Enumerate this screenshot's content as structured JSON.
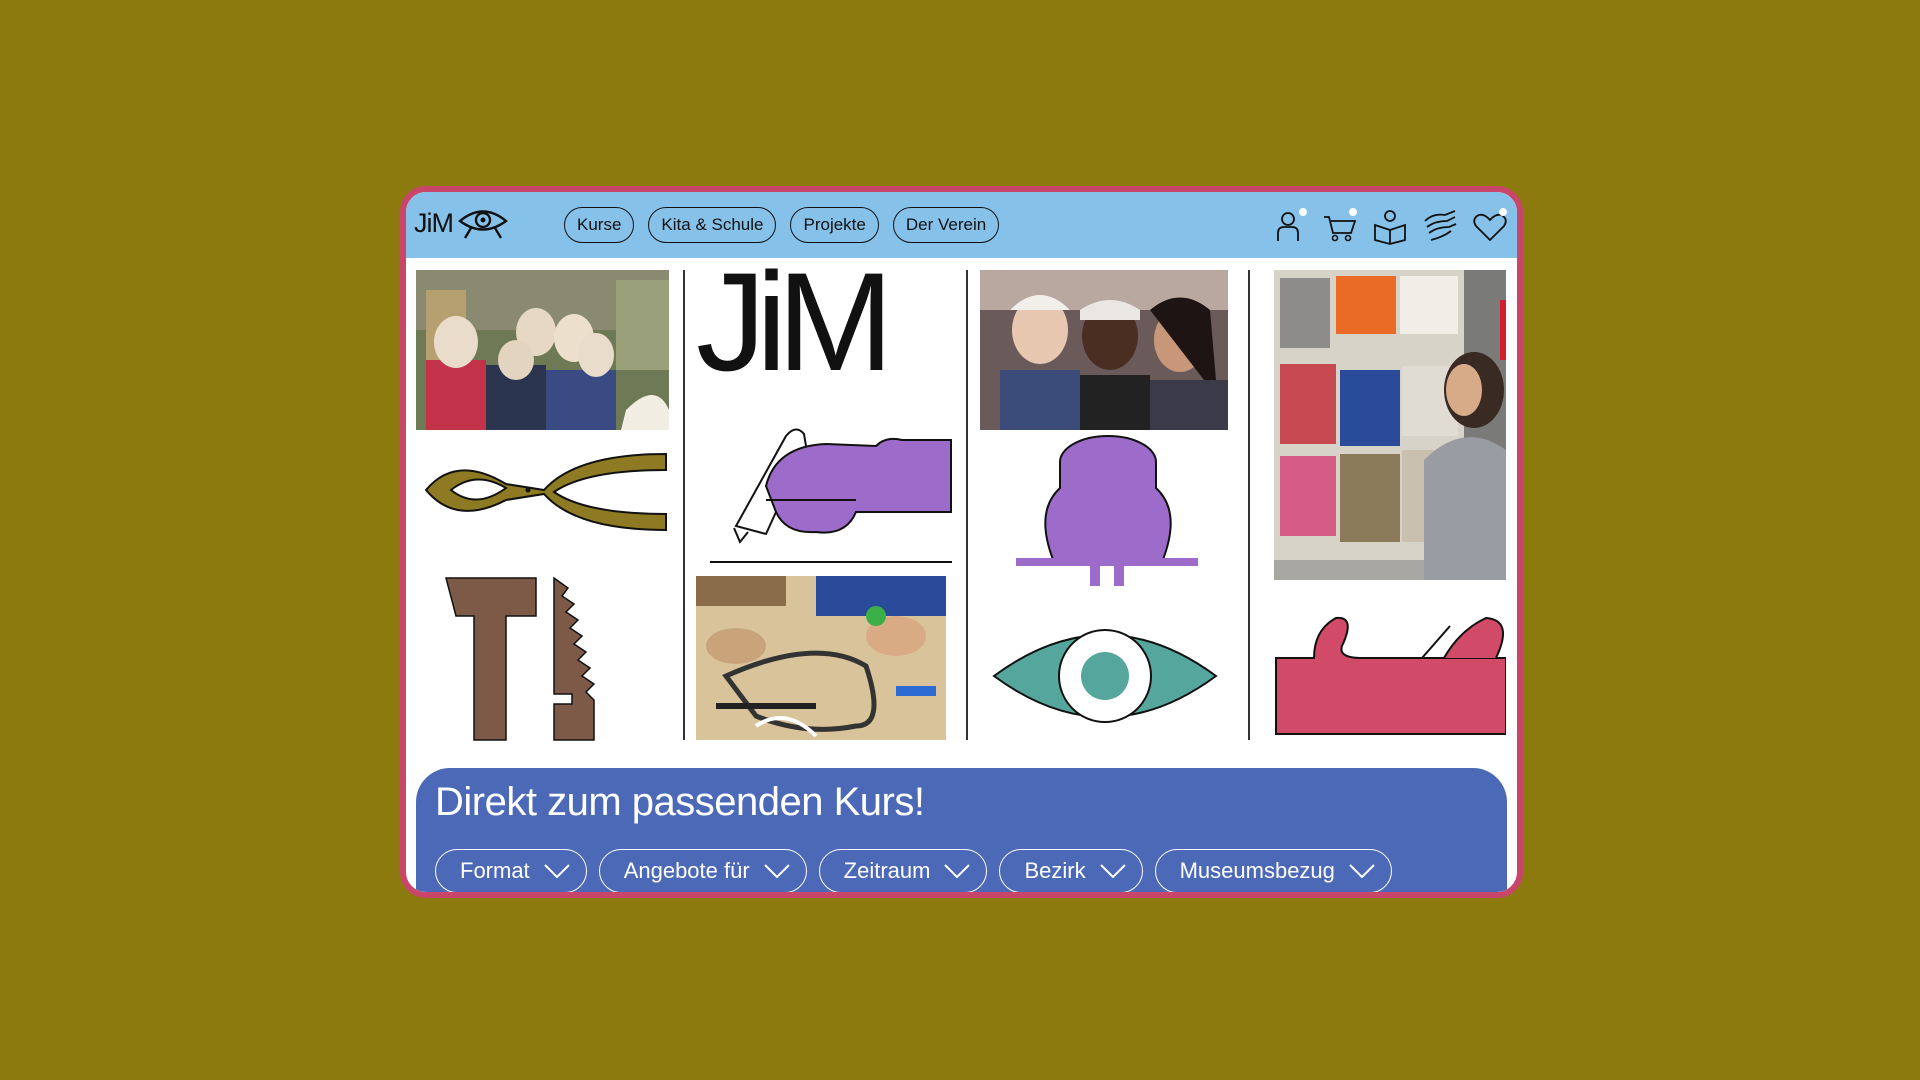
{
  "page": {
    "background": "#8c7a0e",
    "frame_color": "#c9466a",
    "header_color": "#86c1ea",
    "filter_panel_color": "#4c69b8"
  },
  "header": {
    "logo_text": "JiM",
    "nav": [
      {
        "label": "Kurse"
      },
      {
        "label": "Kita & Schule"
      },
      {
        "label": "Projekte"
      },
      {
        "label": "Der Verein"
      }
    ],
    "icons": [
      "user-icon",
      "cart-icon",
      "book-reader-icon",
      "helping-hands-icon",
      "heart-icon"
    ]
  },
  "hero": {
    "big_logo": "JiM",
    "illustrations": [
      "pliers-icon",
      "hammer-saw-icon",
      "drawing-hand-icon",
      "pot-icon",
      "eye-icon",
      "plane-tool-icon"
    ],
    "photos": [
      "kids-masks-photo",
      "girls-photo",
      "collage-photo",
      "saw-workshop-photo"
    ]
  },
  "filter": {
    "title": "Direkt zum passenden Kurs!",
    "chips": [
      {
        "label": "Format"
      },
      {
        "label": "Angebote für"
      },
      {
        "label": "Zeitraum"
      },
      {
        "label": "Bezirk"
      },
      {
        "label": "Museumsbezug"
      }
    ]
  }
}
